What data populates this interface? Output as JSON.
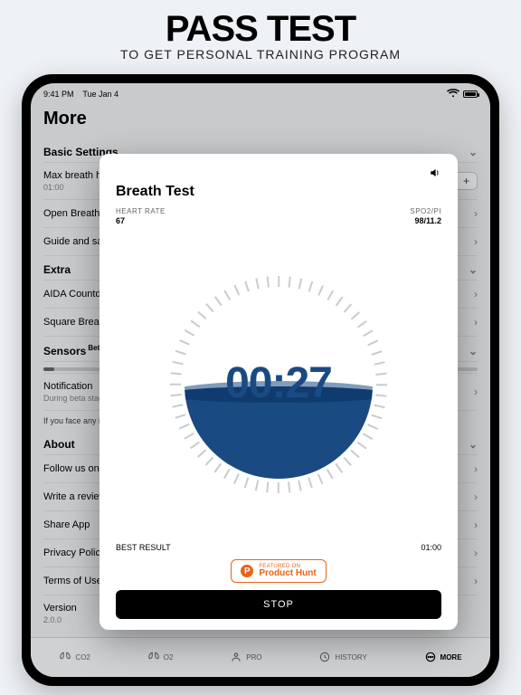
{
  "hero": {
    "title": "PASS TEST",
    "subtitle": "TO GET PERSONAL TRAINING PROGRAM"
  },
  "statusbar": {
    "time": "9:41 PM",
    "date": "Tue Jan 4"
  },
  "page": {
    "title": "More"
  },
  "sections": {
    "basic": {
      "header": "Basic Settings",
      "rows": {
        "max_breath": {
          "label": "Max breath ho",
          "sub": "01:00"
        },
        "open_hold": {
          "label": "Open Breath h"
        },
        "guide": {
          "label": "Guide and safe"
        }
      }
    },
    "extra": {
      "header": "Extra",
      "rows": {
        "aida": {
          "label": "AIDA Countdo"
        },
        "square": {
          "label": "Square Breath"
        }
      }
    },
    "sensors": {
      "header": "Sensors",
      "badge": "Beta",
      "rows": {
        "notification": {
          "label": "Notification",
          "sub": "During beta stage"
        },
        "issue": {
          "label": "If you face any is"
        }
      }
    },
    "about": {
      "header": "About",
      "rows": {
        "follow": {
          "label": "Follow us on In"
        },
        "review": {
          "label": "Write a review"
        },
        "share": {
          "label": "Share App"
        },
        "privacy": {
          "label": "Privacy Policy"
        },
        "terms": {
          "label": "Terms of Use"
        },
        "version": {
          "label": "Version",
          "sub": "2.0.0"
        }
      }
    }
  },
  "tabs": {
    "co2": "CO2",
    "o2": "O2",
    "pro": "PRO",
    "history": "HISTORY",
    "more": "MORE"
  },
  "modal": {
    "title": "Breath Test",
    "heart_label": "HEART RATE",
    "heart_value": "67",
    "spo2_label": "SPO2/PI",
    "spo2_value": "98/11.2",
    "timer": "00:27",
    "best_label": "BEST RESULT",
    "best_value": "01:00",
    "ph_small": "FEATURED ON",
    "ph_big": "Product Hunt",
    "stop": "STOP"
  }
}
